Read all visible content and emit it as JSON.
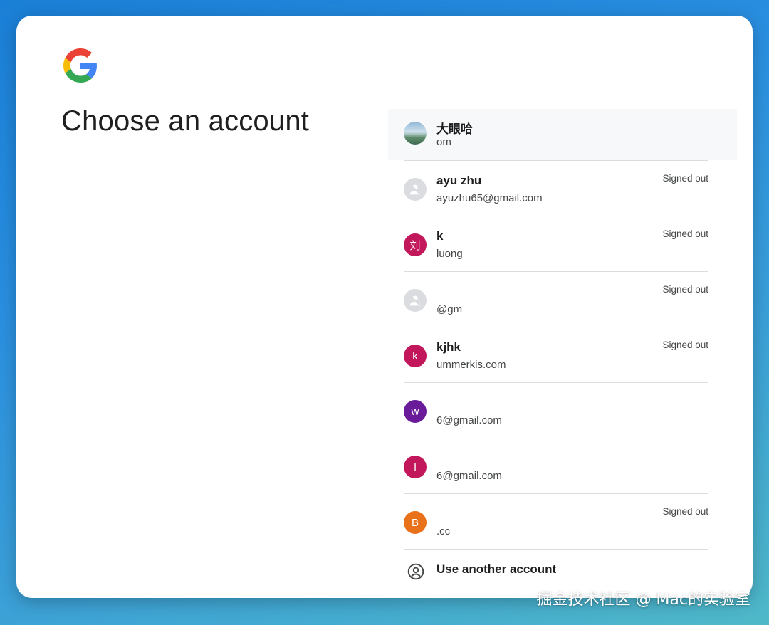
{
  "page_title": "Choose an account",
  "colors": {
    "accent_red": "#c2185b",
    "accent_purple": "#6a1b9a",
    "accent_orange": "#e8711a",
    "text_primary": "#1f1f1f",
    "text_secondary": "#444746"
  },
  "accounts": [
    {
      "name": "大眼哈",
      "email": "om",
      "status": "",
      "avatar_type": "photo",
      "avatar_letter": "",
      "avatar_color": ""
    },
    {
      "name": "ayu zhu",
      "email": "ayuzhu65@gmail.com",
      "status": "Signed out",
      "avatar_type": "default",
      "avatar_letter": "",
      "avatar_color": ""
    },
    {
      "name": "k",
      "email": "luong",
      "status": "Signed out",
      "avatar_type": "letter",
      "avatar_letter": "刘",
      "avatar_color": "#c2185b"
    },
    {
      "name": "",
      "email": "@gm",
      "status": "Signed out",
      "avatar_type": "default",
      "avatar_letter": "",
      "avatar_color": ""
    },
    {
      "name": "kjhk",
      "email": "ummerkis.com",
      "status": "Signed out",
      "avatar_type": "letter",
      "avatar_letter": "k",
      "avatar_color": "#c2185b"
    },
    {
      "name": "",
      "email": "6@gmail.com",
      "status": "",
      "avatar_type": "letter",
      "avatar_letter": "w",
      "avatar_color": "#6a1b9a"
    },
    {
      "name": "",
      "email": "6@gmail.com",
      "status": "",
      "avatar_type": "letter",
      "avatar_letter": "l",
      "avatar_color": "#c2185b"
    },
    {
      "name": "",
      "email": ".cc",
      "status": "Signed out",
      "avatar_type": "letter",
      "avatar_letter": "B",
      "avatar_color": "#e8711a"
    }
  ],
  "use_another_label": "Use another account",
  "watermark": "掘金技术社区 @ Mac的实验室",
  "icons": {
    "logo": "google-logo",
    "default_avatar": "person-off-icon",
    "use_another": "account-circle-icon"
  }
}
